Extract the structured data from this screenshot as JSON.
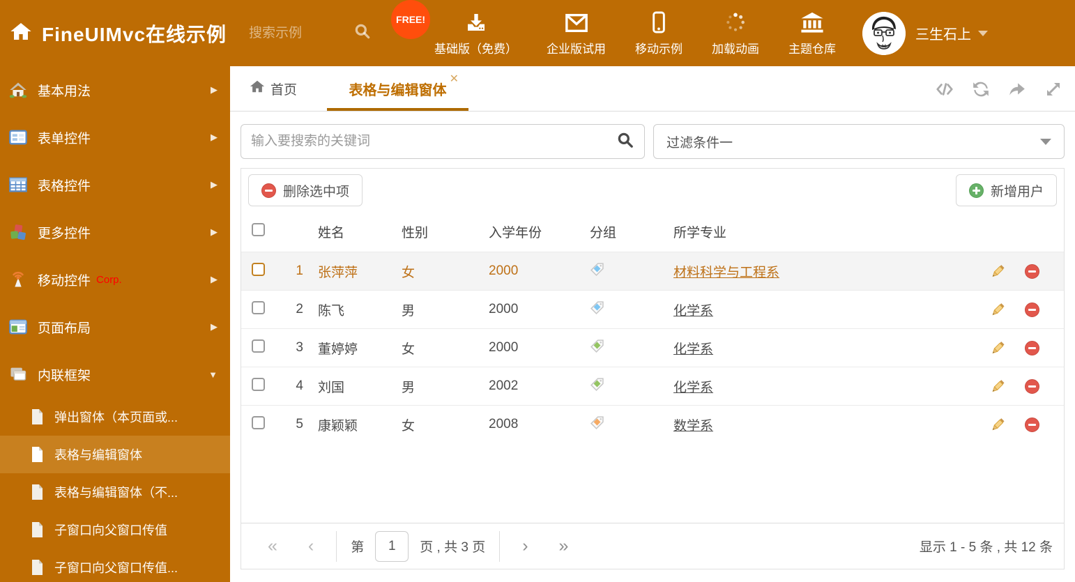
{
  "colors": {
    "primary": "#BD6C04",
    "sidebar_selected_bg": "#C8801F",
    "active_tab_text": "#BE6E00",
    "active_tab_underline": "#AE6A00",
    "selected_row_text": "#BE7117",
    "free_badge_bg": "#FF4E0C",
    "danger_red": "#E2574C",
    "success_green": "#67B168",
    "tag_blue": "#7FC6F2",
    "tag_green": "#94C462",
    "tag_orange": "#F6AA63"
  },
  "header": {
    "title": "FineUIMvc在线示例",
    "search_placeholder": "搜索示例",
    "free_badge": "FREE!",
    "nav": [
      {
        "label": "基础版（免费）",
        "icon": "download-icon"
      },
      {
        "label": "企业版试用",
        "icon": "envelope-icon"
      },
      {
        "label": "移动示例",
        "icon": "mobile-icon"
      },
      {
        "label": "加载动画",
        "icon": "spinner-icon"
      },
      {
        "label": "主题仓库",
        "icon": "bank-icon"
      }
    ],
    "user_name": "三生石上"
  },
  "sidebar": {
    "items": [
      {
        "label": "基本用法"
      },
      {
        "label": "表单控件"
      },
      {
        "label": "表格控件"
      },
      {
        "label": "更多控件"
      },
      {
        "label": "移动控件",
        "badge": "Corp."
      },
      {
        "label": "页面布局"
      },
      {
        "label": "内联框架"
      }
    ],
    "children": [
      {
        "label": "弹出窗体（本页面或..."
      },
      {
        "label": "表格与编辑窗体"
      },
      {
        "label": "表格与编辑窗体（不..."
      },
      {
        "label": "子窗口向父窗口传值"
      },
      {
        "label": "子窗口向父窗口传值..."
      }
    ]
  },
  "tabs": {
    "home": "首页",
    "active": "表格与编辑窗体"
  },
  "main": {
    "search_placeholder": "输入要搜索的关键词",
    "filter_value": "过滤条件一",
    "delete_button": "删除选中项",
    "add_button": "新增用户",
    "table": {
      "columns": {
        "name": "姓名",
        "gender": "性别",
        "year": "入学年份",
        "group": "分组",
        "major": "所学专业"
      },
      "rows": [
        {
          "num": "1",
          "name": "张萍萍",
          "gender": "女",
          "year": "2000",
          "tag_color": "#7FC6F2",
          "major": "材料科学与工程系"
        },
        {
          "num": "2",
          "name": "陈飞",
          "gender": "男",
          "year": "2000",
          "tag_color": "#7FC6F2",
          "major": "化学系"
        },
        {
          "num": "3",
          "name": "董婷婷",
          "gender": "女",
          "year": "2000",
          "tag_color": "#94C462",
          "major": "化学系"
        },
        {
          "num": "4",
          "name": "刘国",
          "gender": "男",
          "year": "2002",
          "tag_color": "#94C462",
          "major": "化学系"
        },
        {
          "num": "5",
          "name": "康颖颖",
          "gender": "女",
          "year": "2008",
          "tag_color": "#F6AA63",
          "major": "数学系"
        }
      ]
    },
    "pagination": {
      "prefix": "第",
      "page": "1",
      "suffix": "页 , 共 3 页",
      "summary": "显示 1 - 5 条 , 共 12 条"
    }
  }
}
